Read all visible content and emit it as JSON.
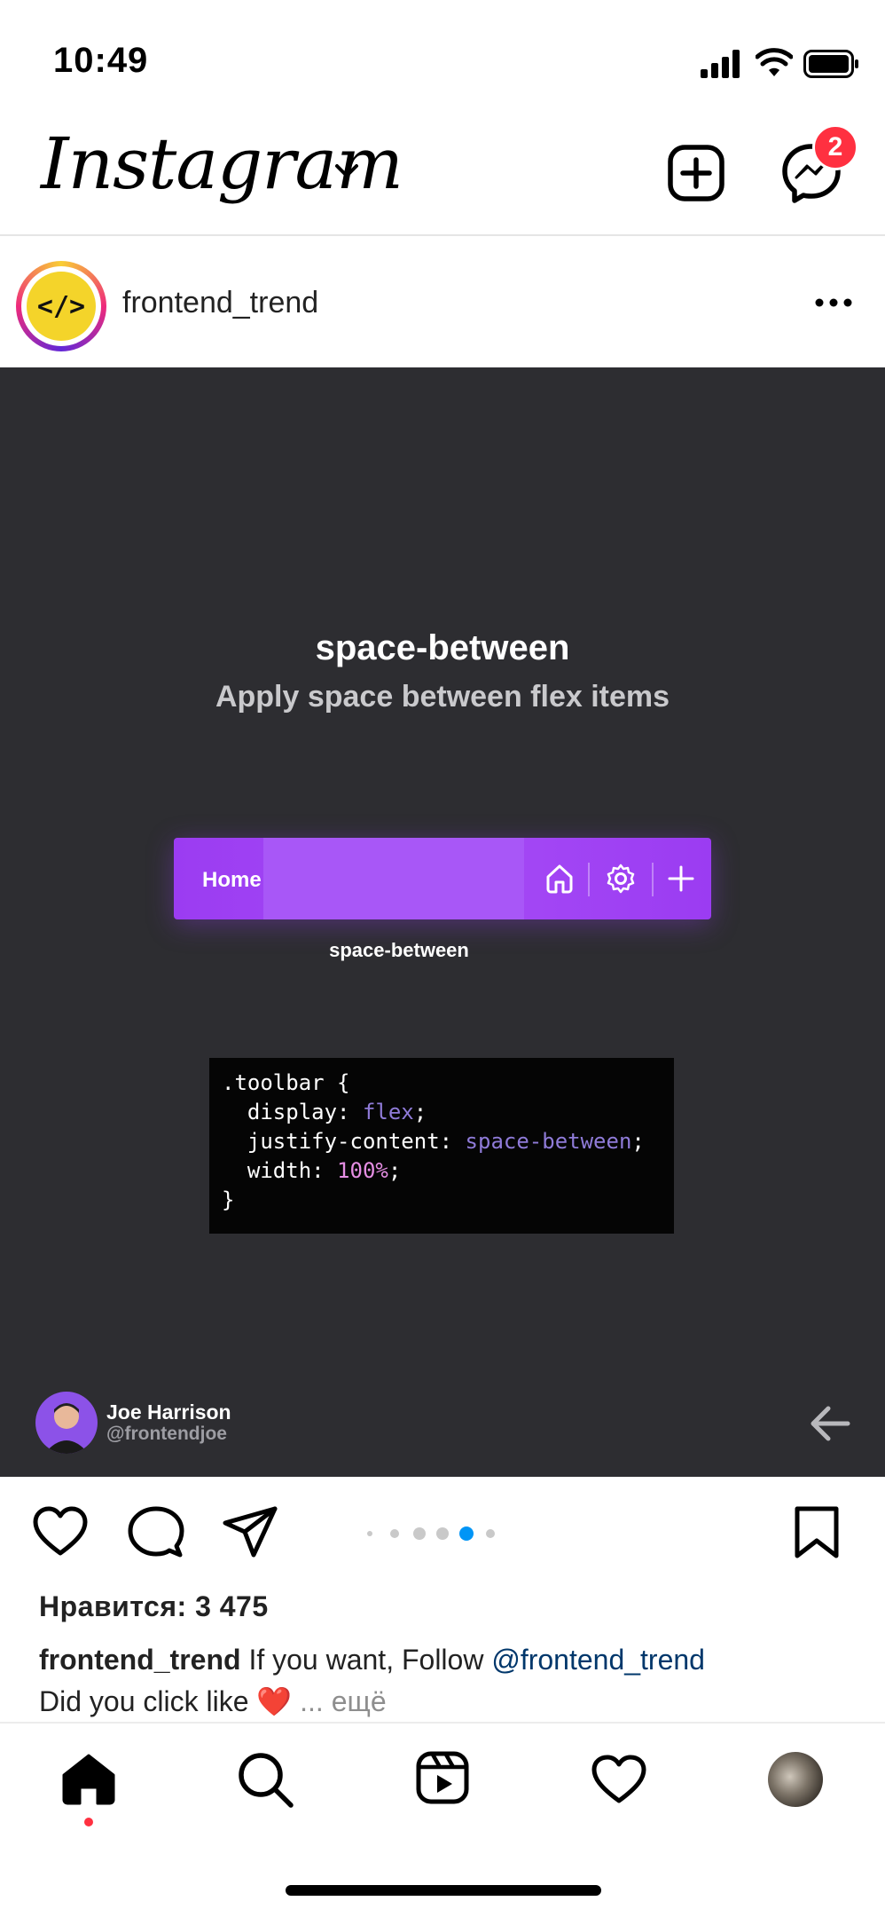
{
  "status_bar": {
    "time": "10:49"
  },
  "header": {
    "logo_text": "Instagram",
    "messages_badge": "2"
  },
  "post": {
    "username": "frontend_trend",
    "avatar_text": "</>",
    "slide": {
      "title": "space-between",
      "subtitle": "Apply space between flex items",
      "toolbar_label": "Home",
      "toolbar_caption": "space-between",
      "code": {
        "line1": ".toolbar {",
        "line2_prop": "  display: ",
        "line2_val": "flex",
        "line2_end": ";",
        "line3_prop": "  justify-content: ",
        "line3_val": "space-between",
        "line3_end": ";",
        "line4_prop": "  width: ",
        "line4_val": "100%",
        "line4_end": ";",
        "line5": "}"
      },
      "author_name": "Joe Harrison",
      "author_handle": "@frontendjoe"
    },
    "carousel": {
      "count": 5,
      "active_index": 3
    },
    "likes_text": "Нравится: 3 475",
    "caption": {
      "user": "frontend_trend",
      "text": " If you want, Follow ",
      "mention": "@frontend_trend",
      "line2": "Did you click like ❤️ ",
      "more": "... ещё"
    }
  },
  "colors": {
    "accent_red": "#ff3040",
    "media_bg": "#2d2d31",
    "toolbar_purple": "#9b3cf2",
    "active_dot": "#0095f6"
  },
  "icons": [
    "signal-icon",
    "wifi-icon",
    "battery-icon",
    "chevron-down-icon",
    "new-post-icon",
    "messenger-icon",
    "more-icon",
    "heart-icon",
    "comment-icon",
    "share-icon",
    "bookmark-icon",
    "home-icon",
    "search-icon",
    "reels-icon",
    "activity-icon",
    "back-arrow-icon"
  ]
}
